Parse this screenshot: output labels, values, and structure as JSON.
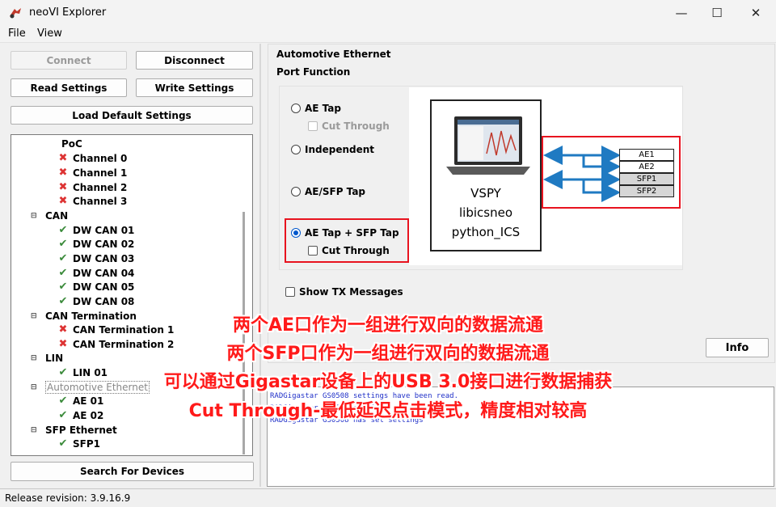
{
  "window": {
    "title": "neoVI Explorer",
    "minimize": "—",
    "maximize": "☐",
    "close": "✕"
  },
  "menu": {
    "file": "File",
    "view": "View"
  },
  "buttons": {
    "connect": "Connect",
    "disconnect": "Disconnect",
    "read_settings": "Read Settings",
    "write_settings": "Write Settings",
    "load_defaults": "Load Default Settings",
    "search": "Search For Devices",
    "info": "Info"
  },
  "tree": {
    "poc": "PoC",
    "channel0": "Channel 0",
    "channel1": "Channel 1",
    "channel2": "Channel 2",
    "channel3": "Channel 3",
    "can": "CAN",
    "dwcan01": "DW CAN 01",
    "dwcan02": "DW CAN 02",
    "dwcan03": "DW CAN 03",
    "dwcan04": "DW CAN 04",
    "dwcan05": "DW CAN 05",
    "dwcan08": "DW CAN 08",
    "can_term": "CAN Termination",
    "can_term1": "CAN Termination 1",
    "can_term2": "CAN Termination 2",
    "lin": "LIN",
    "lin01": "LIN 01",
    "auto_eth": "Automotive Ethernet",
    "ae01": "AE 01",
    "ae02": "AE 02",
    "sfp_eth": "SFP Ethernet",
    "sfp1": "SFP1"
  },
  "panel": {
    "group_title": "Automotive Ethernet",
    "port_function": "Port Function",
    "opt_ae_tap": "AE Tap",
    "opt_cut_through_1": "Cut Through",
    "opt_independent": "Independent",
    "opt_ae_sfp_tap": "AE/SFP Tap",
    "opt_ae_tap_sfp_tap": "AE Tap + SFP Tap",
    "opt_cut_through_2": "Cut Through",
    "show_tx": "Show TX Messages",
    "selected": "AE Tap + SFP Tap"
  },
  "diagram": {
    "sw1": "VSPY",
    "sw2": "libicsneo",
    "sw3": "python_ICS",
    "ports": [
      "AE1",
      "AE2",
      "SFP1",
      "SFP2"
    ]
  },
  "log": {
    "line1": "RADGigastar GS0508 settings have been read.",
    "line2": "RADGigastar GS0508 settings",
    "line3": "RADGigastar GS0508 has set settings"
  },
  "status": {
    "release": "Release revision: 3.9.16.9"
  },
  "overlay": {
    "line1": "两个AE口作为一组进行双向的数据流通",
    "line2": "两个SFP口作为一组进行双向的数据流通",
    "line3": "可以通过Gigastar设备上的USB 3.0接口进行数据捕获",
    "line4": "Cut Through-最低延迟点击模式，精度相对较高"
  },
  "colors": {
    "highlight": "#e8131f",
    "arrow": "#1f7ac2",
    "radio_on": "#0058cc",
    "overlay_text": "#ff1a1a"
  },
  "icons": {
    "error": "x-icon",
    "ok": "check-icon",
    "collapse": "minus-box-icon"
  }
}
